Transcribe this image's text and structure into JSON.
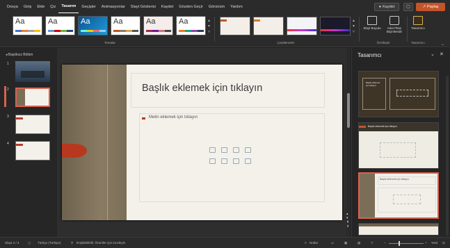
{
  "menu": {
    "tabs": [
      "Dosya",
      "Giriş",
      "Ekle",
      "Çiz",
      "Tasarım",
      "Geçişler",
      "Animasyonlar",
      "Slayt Gösterisi",
      "Kaydet",
      "Gözden Geçir",
      "Görünüm",
      "Yardım"
    ],
    "active_tab": "Tasarım",
    "save_label": "Kaydet",
    "share_label": "Paylaş"
  },
  "ribbon": {
    "theme_sample": "Aa",
    "groups": {
      "themes": "Temalar",
      "variants": "Çeşitlemeler",
      "customize": "Özelleştir",
      "designer": "Tasarımcı"
    },
    "buttons": {
      "slide_size": "Slayt Boyutu",
      "bg_format": "Arka Planı Biçimlendir",
      "designer": "Tasarımcı"
    }
  },
  "slide_panel": {
    "section_header": "Başlıksız Bölüm",
    "slide_numbers": [
      "1",
      "2",
      "3",
      "4"
    ]
  },
  "slide": {
    "title_placeholder": "Başlık eklemek için tıklayın",
    "body_placeholder": "Metin eklemek için tıklayın"
  },
  "design_pane": {
    "title": "Tasarımcı",
    "card_title": "Başlık eklemek için tıklayın"
  },
  "status": {
    "slide_info": "Slayt 2 / 4",
    "language": "Türkçe (Türkiye)",
    "accessibility": "Erişilebilirlik: Öneriler için inceleyin",
    "notes": "Notlar",
    "zoom": "%63"
  },
  "colors": {
    "accent": "#c4542a",
    "slide_bg": "#f3f1ea",
    "selection": "#d9624e"
  }
}
